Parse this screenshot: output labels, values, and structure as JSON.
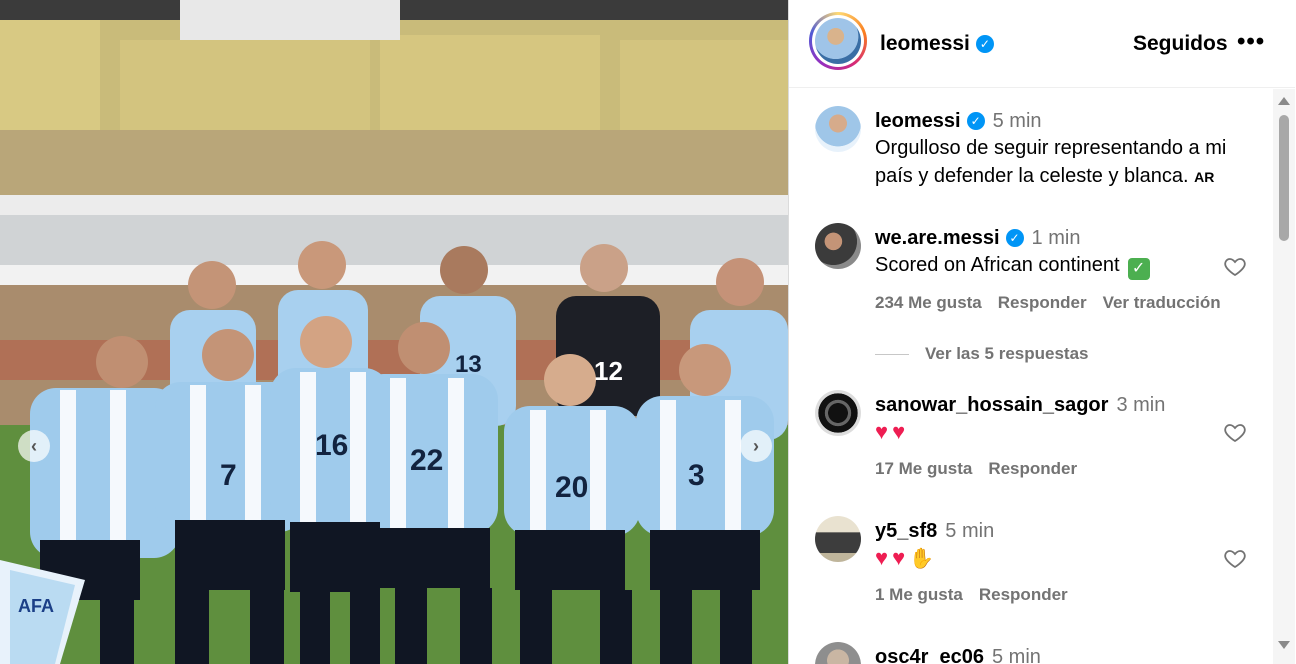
{
  "post": {
    "photo_alt": "Argentina national team photo",
    "jersey_numbers": [
      "7",
      "16",
      "22",
      "13",
      "12",
      "20",
      "3"
    ],
    "pennant_text": "AFA"
  },
  "header": {
    "username": "leomessi",
    "follow_label": "Seguidos",
    "more_label": "•••"
  },
  "caption": {
    "username": "leomessi",
    "time": "5 min",
    "text": "Orgulloso de seguir representando a mi país y defender la celeste y blanca.",
    "tag": "AR"
  },
  "comments": [
    {
      "username": "we.are.messi",
      "verified": true,
      "time": "1 min",
      "text": "Scored on African continent",
      "likes": "234 Me gusta",
      "reply": "Responder",
      "translate": "Ver traducción",
      "view_replies": "Ver las 5 respuestas"
    },
    {
      "username": "sanowar_hossain_sagor",
      "time": "3 min",
      "text": "",
      "likes": "17 Me gusta",
      "reply": "Responder"
    },
    {
      "username": "y5_sf8",
      "time": "5 min",
      "text": "",
      "likes": "1 Me gusta",
      "reply": "Responder"
    },
    {
      "username": "osc4r_ec06",
      "time": "5 min"
    }
  ],
  "colors": {
    "verified": "#0095f6",
    "heart_emoji": "#ee1d52",
    "meta_text": "#737373"
  }
}
